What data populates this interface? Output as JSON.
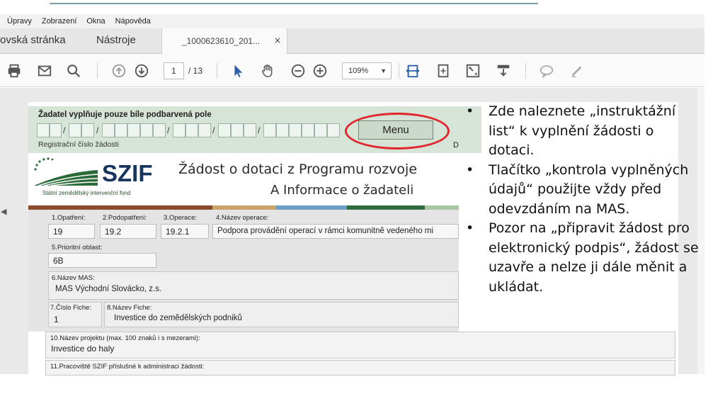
{
  "app": {
    "menu": [
      "Úpravy",
      "Zobrazení",
      "Okna",
      "Nápověda"
    ],
    "tabs": {
      "home": "ovská stránka",
      "tools": "Nástroje",
      "document": "_1000623610_201...",
      "close_glyph": "×"
    },
    "toolbar": {
      "page_current": "1",
      "page_total": "/ 13",
      "zoom": "109%",
      "icons": [
        "print-icon",
        "email-icon",
        "search-icon",
        "page-up-icon",
        "page-down-icon",
        "select-cursor-icon",
        "hand-tool-icon",
        "zoom-out-icon",
        "zoom-in-icon",
        "fit-width-icon",
        "fit-page-icon",
        "fullscreen-icon",
        "read-mode-icon",
        "comment-icon",
        "sign-icon"
      ]
    }
  },
  "form": {
    "header_note": "Žadatel vyplňuje pouze bíle podbarvená pole",
    "registration_label": "Registrační číslo žádosti",
    "menu_button": "Menu",
    "header_right_letter": "D",
    "logo_text": "SZIF",
    "logo_subtitle": "Státní zemědělský intervenční fond",
    "title": "Žádost o dotaci z Programu rozvoje",
    "subtitle": "A Informace o žadateli",
    "fields": {
      "opatreni_label": "1.Opatření:",
      "opatreni_value": "19",
      "podopatreni_label": "2.Podopatření:",
      "podopatreni_value": "19.2",
      "operace_label": "3.Operace:",
      "operace_value": "19.2.1",
      "nazev_operace_label": "4.Název operace:",
      "nazev_operace_value": "Podpora provádění operací v rámci komunitně vedeného mi",
      "prioritni_label": "5.Prioritní oblast:",
      "prioritni_value": "6B",
      "mas_label": "6.Název MAS:",
      "mas_value": "MAS Východní Slovácko, z.s.",
      "fiche_cislo_label": "7.Číslo Fiche:",
      "fiche_cislo_value": "1",
      "fiche_nazev_label": "8.Název Fiche:",
      "fiche_nazev_value": "Investice do zemědělských podniků",
      "projekt_label": "10.Název projektu (max. 100 znaků i s mezerami):",
      "projekt_value": "Investice do haly",
      "pracoviste_label": "11.Pracoviště SZIF příslušné k administraci žádosti:"
    },
    "colors": {
      "accent_red": "#e1262c",
      "header_green": "#d6e3d7",
      "bar": [
        "#8b4a2b",
        "#c8a46a",
        "#6b9fc7",
        "#2f6a40",
        "#a9c4a0"
      ]
    }
  },
  "notes": {
    "bullet": "•",
    "items": [
      "Zde naleznete „instruktážní list“ k vyplnění žádosti o dotaci.",
      "Tlačítko „kontrola vyplněných údajů“ použijte vždy před odevzdáním na MAS.",
      "Pozor na „připravit žádost pro elektronický podpis“, žádost se uzavře a nelze ji dále měnit a ukládat."
    ]
  }
}
